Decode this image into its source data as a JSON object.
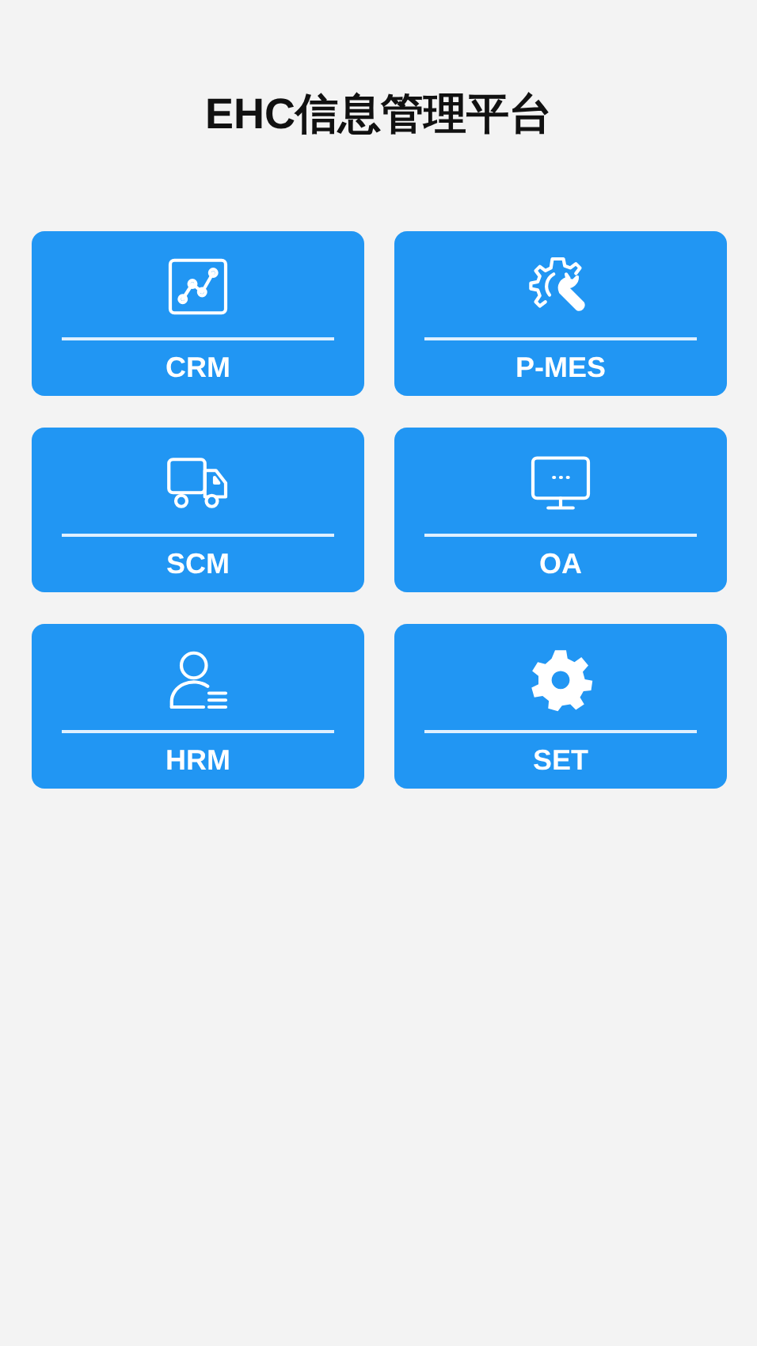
{
  "title": "EHC信息管理平台",
  "modules": [
    {
      "label": "CRM"
    },
    {
      "label": "P-MES"
    },
    {
      "label": "SCM"
    },
    {
      "label": "OA"
    },
    {
      "label": "HRM"
    },
    {
      "label": "SET"
    }
  ]
}
